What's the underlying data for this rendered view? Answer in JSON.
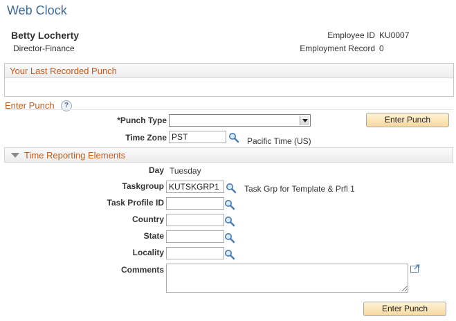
{
  "page": {
    "title": "Web Clock"
  },
  "employee": {
    "name": "Betty Locherty",
    "job_title": "Director-Finance",
    "id_label": "Employee ID",
    "id_value": "KU0007",
    "record_label": "Employment Record",
    "record_value": "0"
  },
  "last_punch": {
    "header": "Your Last Recorded Punch"
  },
  "enter_punch": {
    "header": "Enter Punch",
    "help_icon_glyph": "?",
    "punch_type_label": "*Punch Type",
    "punch_type_value": "",
    "time_zone_label": "Time Zone",
    "time_zone_value": "PST",
    "time_zone_desc": "Pacific Time (US)",
    "button_label": "Enter Punch"
  },
  "tre": {
    "header": "Time Reporting Elements",
    "day_label": "Day",
    "day_value": "Tuesday",
    "taskgroup_label": "Taskgroup",
    "taskgroup_value": "KUTSKGRP1",
    "taskgroup_desc": "Task Grp for Template & Prfl 1",
    "task_profile_label": "Task Profile ID",
    "task_profile_value": "",
    "country_label": "Country",
    "country_value": "",
    "state_label": "State",
    "state_value": "",
    "locality_label": "Locality",
    "locality_value": "",
    "comments_label": "Comments",
    "comments_value": ""
  },
  "footer": {
    "button_label": "Enter Punch"
  },
  "colors": {
    "title": "#3d6a99",
    "section_header": "#bf5b19",
    "button": "#f7d9a0"
  },
  "icons": [
    "help-icon",
    "lookup-icon",
    "collapse-triangle-icon",
    "expand-textarea-icon"
  ]
}
